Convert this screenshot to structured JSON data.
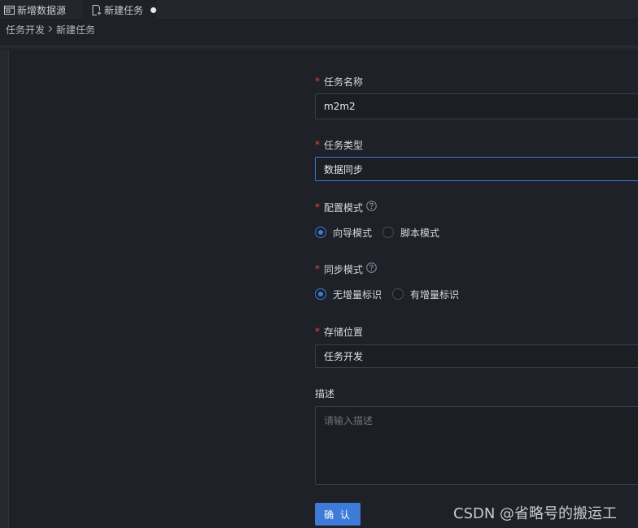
{
  "tabs": [
    {
      "label": "新增数据源",
      "icon": "datasource-icon"
    },
    {
      "label": "新建任务",
      "icon": "new-file-icon",
      "dirty": true
    }
  ],
  "breadcrumb": {
    "items": [
      "任务开发",
      "新建任务"
    ]
  },
  "form": {
    "task_name": {
      "label": "任务名称",
      "required": true,
      "value": "m2m2"
    },
    "task_type": {
      "label": "任务类型",
      "required": true,
      "value": "数据同步"
    },
    "config_mode": {
      "label": "配置模式",
      "required": true,
      "options": [
        "向导模式",
        "脚本模式"
      ],
      "selected": "向导模式"
    },
    "sync_mode": {
      "label": "同步模式",
      "required": true,
      "options": [
        "无增量标识",
        "有增量标识"
      ],
      "selected": "无增量标识"
    },
    "storage_location": {
      "label": "存储位置",
      "required": true,
      "value": "任务开发"
    },
    "description": {
      "label": "描述",
      "required": false,
      "value": "",
      "placeholder": "请输入描述"
    },
    "confirm_label": "确 认"
  },
  "watermark": "CSDN @省略号的搬运工",
  "colors": {
    "accent": "#3e7bd8",
    "required": "#e8453c",
    "background": "#1e2127"
  }
}
